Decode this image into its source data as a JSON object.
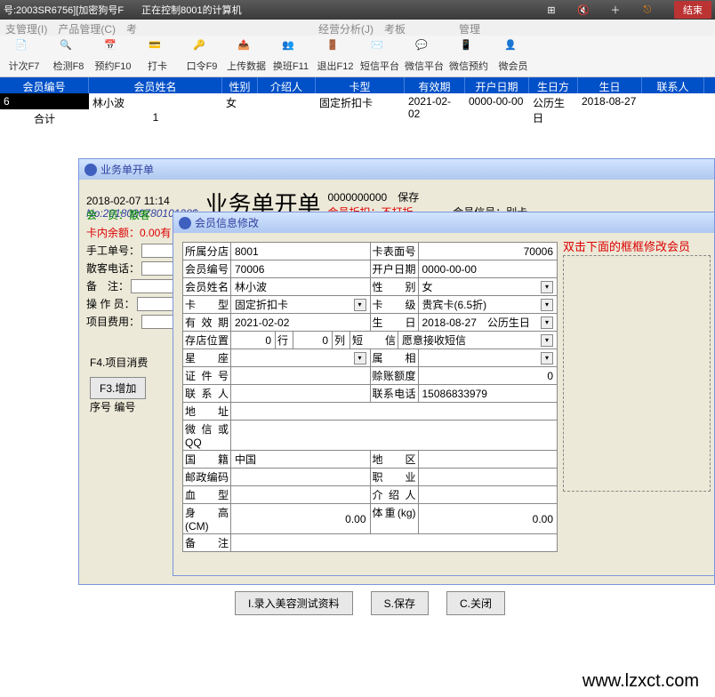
{
  "titlebar": {
    "left": "号:2003SR6756][加密狗号F",
    "center": "正在控制8001的计算机",
    "end": "结束"
  },
  "menubar": "支管理(I)　产品管理(C)　考　　　　　　　　　　　　　　　　　经营分析(J)　考板　　　　　管理",
  "toolbar": [
    "计次F7",
    "检测F8",
    "预约F10",
    "打卡",
    "口令F9",
    "上传数据",
    "换班F11",
    "退出F12",
    "短信平台",
    "微信平台",
    "微信预约",
    "微会员"
  ],
  "grid": {
    "headers": [
      "会员编号",
      "会员姓名",
      "性别",
      "介绍人",
      "卡型",
      "有效期",
      "开户日期",
      "生日方式",
      "生日",
      "联系人"
    ],
    "rows": [
      {
        "id": "6",
        "name": "林小波",
        "sex": "女",
        "ref": "",
        "card": "固定折扣卡",
        "exp": "2021-02-02",
        "open": "0000-00-00",
        "bmode": "公历生日",
        "bday": "2018-08-27",
        "contact": ""
      }
    ],
    "total_label": "合计",
    "total_count": "1"
  },
  "svc": {
    "title": "业务单开单",
    "datetime": "2018-02-07 11:14",
    "no": "No:201802078010128$",
    "big": "业务单开单",
    "zeros": "0000000000",
    "save": "保存",
    "disc_label": "会员折扣：",
    "disc_value": "不打折",
    "mem_no_label": "会员信号：别卡",
    "left": {
      "member": "会　员：",
      "member_val": "散客",
      "balance": "卡内余额：0.00有",
      "manual": "手工单号：",
      "guest_tel": "散客电话：",
      "remark": "备　注：",
      "operator": "操 作 员：",
      "proj_fee": "项目费用："
    },
    "f4": "F4.项目消费",
    "f3": "F3.增加",
    "seq": "序号 编号"
  },
  "mem": {
    "title": "会员信息修改",
    "hint": "双击下面的框框修改会员",
    "labels": {
      "branch": "所属分店",
      "surface": "卡表面号",
      "memno": "会员编号",
      "opendate": "开户日期",
      "name": "会员姓名",
      "sex": "性　　别",
      "cardtype": "卡　　型",
      "cardlevel": "卡　　级",
      "expire": "有 效 期",
      "birth": "生　　日",
      "birthmode": "公历生日",
      "storepos": "存店位置",
      "row": "行",
      "col": "列",
      "sms": "短　　信",
      "zodiac": "星　　座",
      "belong": "属　　相",
      "certno": "证 件 号",
      "credit": "赊账额度",
      "contact": "联 系 人",
      "tel": "联系电话",
      "addr": "地　　址",
      "wechat": "微信或QQ",
      "nation": "国　　籍",
      "region": "地　　区",
      "postcode": "邮政编码",
      "job": "职　　业",
      "blood": "血　　型",
      "referrer": "介 绍 人",
      "height": "身高(CM)",
      "weight": "体重(kg)",
      "note": "备　　注"
    },
    "values": {
      "branch": "8001",
      "surface": "70006",
      "memno": "70006",
      "opendate": "0000-00-00",
      "name": "林小波",
      "sex": "女",
      "cardtype": "固定折扣卡",
      "cardlevel": "贵宾卡(6.5折)",
      "expire": "2021-02-02",
      "birth": "2018-08-27",
      "storepos": "0",
      "row": "0",
      "col": "0",
      "sms": "愿意接收短信",
      "credit": "0",
      "tel": "15086833979",
      "nation": "中国",
      "height": "0.00",
      "weight": "0.00"
    },
    "buttons": {
      "import": "I.录入美容测试资料",
      "save": "S.保存",
      "close": "C.关闭"
    }
  },
  "watermark": "www.lzxct.com"
}
